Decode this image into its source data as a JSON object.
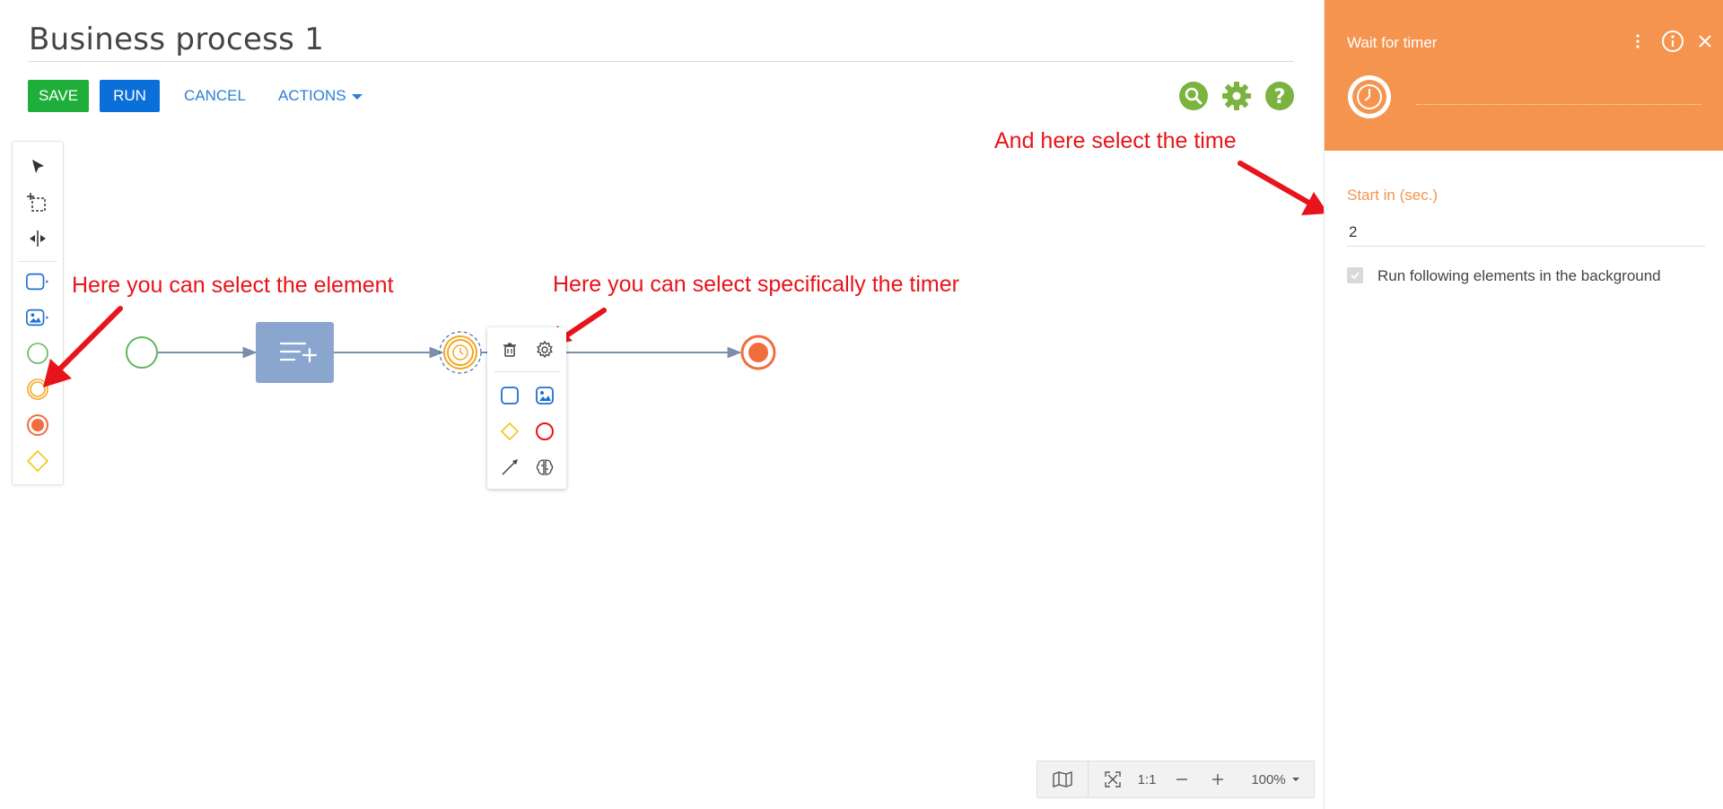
{
  "page": {
    "title": "Business process 1"
  },
  "toolbar": {
    "save_label": "SAVE",
    "run_label": "RUN",
    "cancel_label": "CANCEL",
    "actions_label": "ACTIONS"
  },
  "top_icons": [
    "search-icon",
    "gear-icon",
    "help-icon"
  ],
  "palette": {
    "items": [
      "pointer-tool",
      "lasso-tool",
      "space-tool",
      "task-element",
      "user-task-element",
      "start-event",
      "intermediate-timer-event",
      "end-event",
      "gateway"
    ]
  },
  "context_menu": {
    "items": [
      "delete-icon",
      "settings-icon",
      "task-icon",
      "user-task-icon",
      "gateway-icon",
      "end-event-icon",
      "connector-icon",
      "ai-icon"
    ]
  },
  "annotations": {
    "element": "Here you can select the element",
    "timer": "Here you can select specifically the timer",
    "time": "And here select the time"
  },
  "zoom": {
    "one_to_one": "1:1",
    "level": "100%"
  },
  "panel": {
    "title": "Wait for timer",
    "start_label": "Start in (sec.)",
    "start_value": "2",
    "background_label": "Run following elements in the background",
    "background_checked": true
  },
  "colors": {
    "save": "#1fae3a",
    "run": "#0a6fd8",
    "link": "#2c7fd6",
    "panel_header": "#f5944f",
    "annotation": "#e8141b",
    "start_event": "#5cb85c",
    "timer_event": "#f5a623",
    "end_event": "#f26d3d",
    "task": "#8aa6cf"
  }
}
